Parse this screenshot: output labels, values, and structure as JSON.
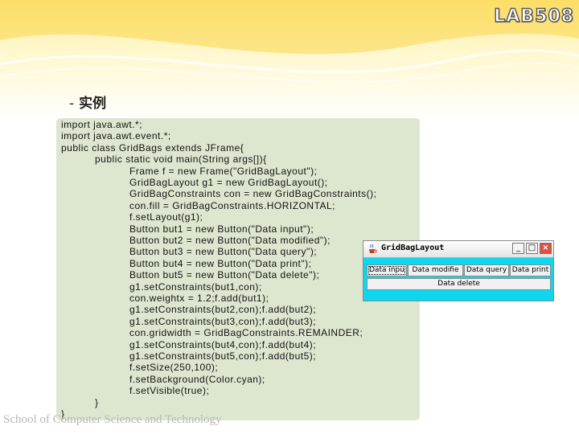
{
  "slide": {
    "logo": "LAB508",
    "heading_dash": "-",
    "heading_title": "实例",
    "footer": "School of Computer Science and Technology"
  },
  "code_lines": [
    "import java.awt.*;",
    "import java.awt.event.*;",
    "public class GridBags extends JFrame{",
    "public static void main(String args[]){",
    "Frame f = new Frame(\"GridBagLayout\");",
    "GridBagLayout g1 = new GridBagLayout();",
    "GridBagConstraints con = new GridBagConstraints();",
    "con.fill = GridBagConstraints.HORIZONTAL;",
    "f.setLayout(g1);",
    "Button but1 = new Button(\"Data input\");",
    "Button but2 = new Button(\"Data modified\");",
    "Button but3 = new Button(\"Data query\");",
    "Button but4 = new Button(\"Data print\");",
    "Button but5 = new Button(\"Data delete\");",
    "g1.setConstraints(but1,con);",
    "con.weightx = 1.2;f.add(but1);",
    "g1.setConstraints(but2,con);f.add(but2);",
    "g1.setConstraints(but3,con);f.add(but3);",
    "con.gridwidth = GridBagConstraints.REMAINDER;",
    "g1.setConstraints(but4,con);f.add(but4);",
    "g1.setConstraints(but5,con);f.add(but5);",
    "f.setSize(250,100);",
    "f.setBackground(Color.cyan);",
    "f.setVisible(true);",
    "}",
    "}"
  ],
  "java_window": {
    "title": "GridBagLayout",
    "minimize": "_",
    "maximize": "□",
    "close": "×",
    "buttons": [
      "Data inpu",
      "Data modifie",
      "Data query",
      "Data print"
    ],
    "delete_button": "Data delete"
  },
  "colors": {
    "code_bg": "#dde7d0",
    "window_bg": "#0ed6ee"
  }
}
